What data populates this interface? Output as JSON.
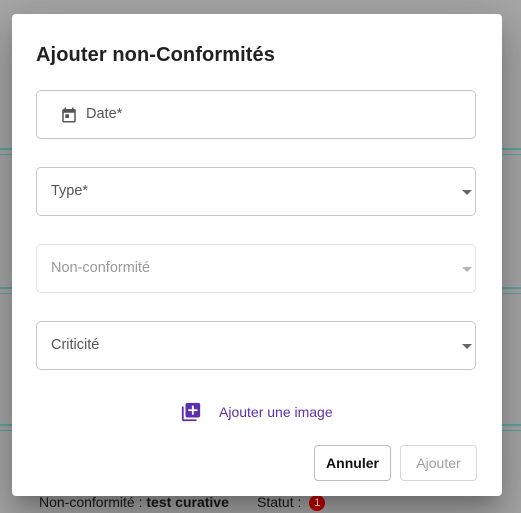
{
  "background": {
    "nonconformite_label": "Non-conformité :",
    "nonconformite_value": "test curative",
    "statut_label": "Statut :",
    "statut_badge": "1"
  },
  "dialog": {
    "title": "Ajouter non-Conformités",
    "fields": {
      "date": {
        "label": "Date*",
        "icon": "calendar-icon"
      },
      "type": {
        "label": "Type*"
      },
      "nonconformite": {
        "label": "Non-conformité",
        "disabled": true
      },
      "criticite": {
        "label": "Criticité"
      }
    },
    "add_image_label": "Ajouter une image",
    "cancel_label": "Annuler",
    "submit_label": "Ajouter"
  },
  "colors": {
    "accent": "#5b2fb0",
    "overlay": "#a6a6a6",
    "badge": "#c40000"
  }
}
